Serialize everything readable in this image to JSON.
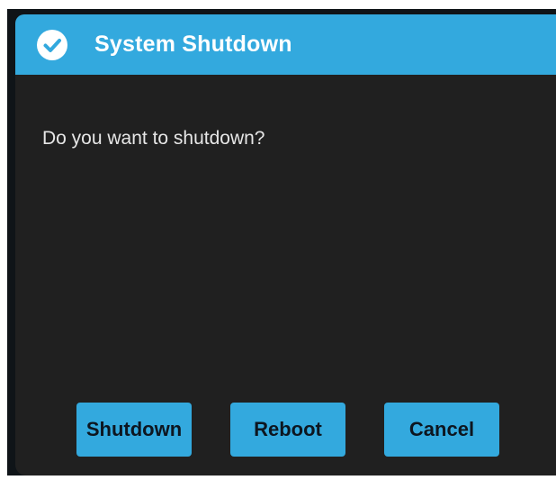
{
  "dialog": {
    "title": "System Shutdown",
    "title_icon": "check-circle-icon",
    "message": "Do you want to shutdown?",
    "buttons": {
      "shutdown": "Shutdown",
      "reboot": "Reboot",
      "cancel": "Cancel"
    }
  },
  "colors": {
    "accent": "#33a9de",
    "dialog_background": "#202020",
    "message_text": "#e6e6e6",
    "button_text": "#0d1620"
  }
}
